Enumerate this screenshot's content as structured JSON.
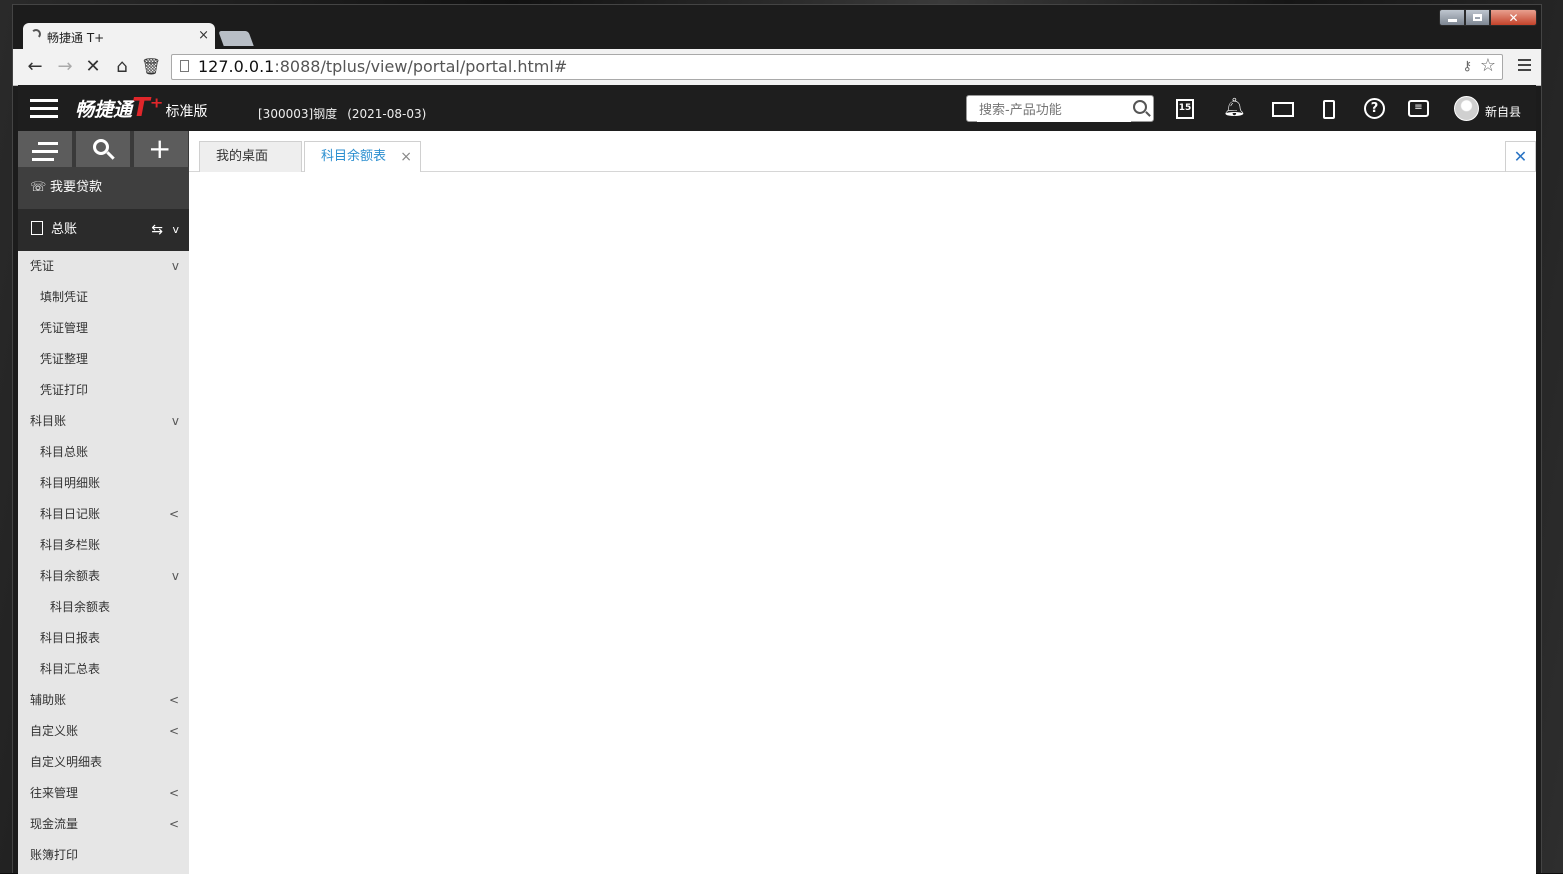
{
  "browser": {
    "tab_title": "畅捷通 T+",
    "tab_close": "×",
    "url_host": "127.0.0.1",
    "url_path": ":8088/tplus/view/portal/portal.html#"
  },
  "header": {
    "brand": "畅捷通",
    "brand_suffix": "T⁺",
    "edition": "标准版",
    "account": "[300003]钢度",
    "date": "(2021-08-03)",
    "search_placeholder": "搜索-产品功能",
    "calendar_day": "15",
    "user_name": "新自县"
  },
  "sidebar": {
    "loan_label": "我要贷款",
    "module_label": "总账",
    "module_chevron": "v",
    "items": [
      {
        "label": "凭证",
        "arrow": "v"
      },
      {
        "label": "填制凭证",
        "arrow": ""
      },
      {
        "label": "凭证管理",
        "arrow": ""
      },
      {
        "label": "凭证整理",
        "arrow": ""
      },
      {
        "label": "凭证打印",
        "arrow": ""
      },
      {
        "label": "科目账",
        "arrow": "v"
      },
      {
        "label": "科目总账",
        "arrow": ""
      },
      {
        "label": "科目明细账",
        "arrow": ""
      },
      {
        "label": "科目日记账",
        "arrow": "<"
      },
      {
        "label": "科目多栏账",
        "arrow": ""
      },
      {
        "label": "科目余额表",
        "arrow": "v"
      },
      {
        "label": "科目余额表",
        "arrow": ""
      },
      {
        "label": "科目日报表",
        "arrow": ""
      },
      {
        "label": "科目汇总表",
        "arrow": ""
      },
      {
        "label": "辅助账",
        "arrow": "<"
      },
      {
        "label": "自定义账",
        "arrow": "<"
      },
      {
        "label": "自定义明细表",
        "arrow": ""
      },
      {
        "label": "往来管理",
        "arrow": "<"
      },
      {
        "label": "现金流量",
        "arrow": "<"
      },
      {
        "label": "账簿打印",
        "arrow": ""
      }
    ]
  },
  "main": {
    "tabs": [
      {
        "label": "我的桌面"
      },
      {
        "label": "科目余额表",
        "close": "×"
      }
    ],
    "close_all": "✕"
  }
}
